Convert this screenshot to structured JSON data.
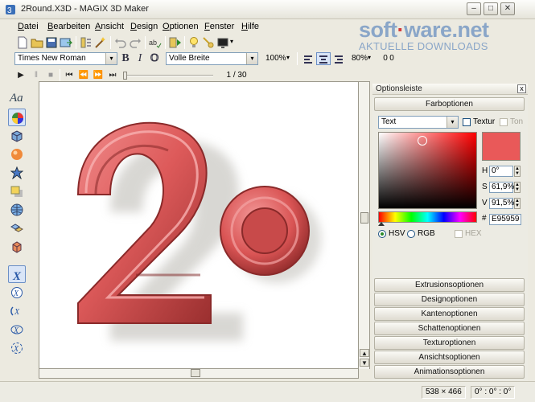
{
  "window": {
    "title": "2Round.X3D - MAGIX 3D Maker",
    "min_glyph": "–",
    "max_glyph": "□",
    "close_glyph": "✕"
  },
  "menu": [
    "Datei",
    "Bearbeiten",
    "Ansicht",
    "Design",
    "Optionen",
    "Fenster",
    "Hilfe"
  ],
  "watermark": {
    "brand_a": "soft",
    "brand_dot": "·",
    "brand_b": "ware.net",
    "sub": "AKTUELLE DOWNLOADS"
  },
  "format_bar": {
    "font": "Times New Roman",
    "bold": "B",
    "italic": "I",
    "outline": "O",
    "width_mode": "Volle Breite",
    "scale": "100%",
    "spacing": "80%",
    "height": "0",
    "offset": "0",
    "arrow": "▾"
  },
  "playback": {
    "play": "▶",
    "pause": "‖",
    "stop": "■",
    "first": "⏮",
    "rewind": "⏪",
    "forward": "⏩",
    "last": "⏭",
    "frame": "1 / 30",
    "progress": 0.0
  },
  "left_tools": {
    "text_tool": "Aa"
  },
  "scroll": {
    "up": "▲",
    "down": "▼",
    "page_up": "▲",
    "page_down": "▼"
  },
  "panel": {
    "title": "Optionsleiste",
    "close": "x",
    "active_section": "Farboptionen",
    "target": "Text",
    "texture_label": "Textur",
    "tone_label": "Ton",
    "hsv": {
      "h_label": "H",
      "h": "0°",
      "s_label": "S",
      "s": "61,9%",
      "v_label": "V",
      "v": "91,5%"
    },
    "hex_label": "#",
    "hex": "E95959",
    "modes": [
      "HSV",
      "RGB",
      "HEX"
    ],
    "selected_mode": "HSV",
    "sections": [
      "Extrusionsoptionen",
      "Designoptionen",
      "Kantenoptionen",
      "Schattenoptionen",
      "Texturoptionen",
      "Ansichtsoptionen",
      "Animationsoptionen"
    ]
  },
  "colors": {
    "object": "#e15d5d",
    "swatch": "#e95959",
    "shadow": "#b9b7b0"
  },
  "status": {
    "size": "538 × 466",
    "angles": "0° : 0° : 0°"
  }
}
